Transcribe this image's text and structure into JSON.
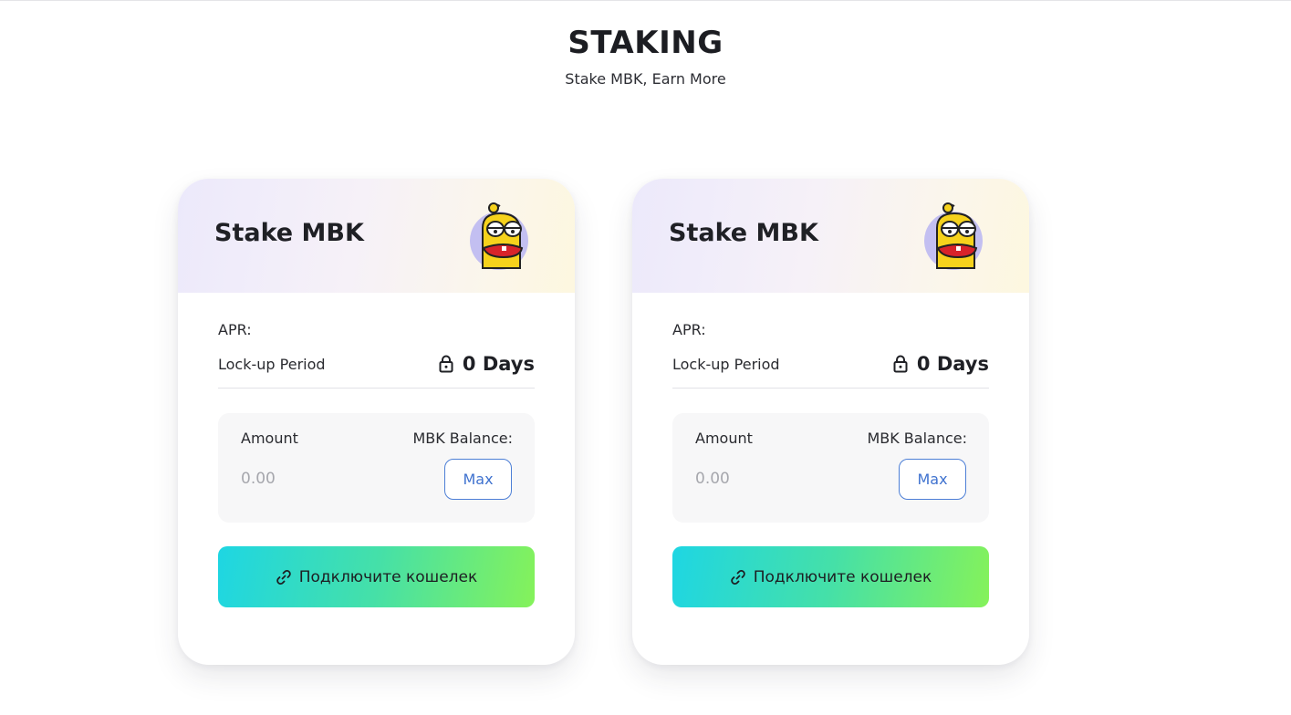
{
  "header": {
    "title": "STAKING",
    "subtitle": "Stake MBK, Earn More"
  },
  "cards": [
    {
      "title": "Stake MBK",
      "apr_label": "APR:",
      "lock_label": "Lock-up Period",
      "lock_value": "0 Days",
      "amount_label": "Amount",
      "balance_label": "MBK Balance:",
      "amount_placeholder": "0.00",
      "max_label": "Max",
      "connect_label": "Подключите кошелек"
    },
    {
      "title": "Stake MBK",
      "apr_label": "APR:",
      "lock_label": "Lock-up Period",
      "lock_value": "0 Days",
      "amount_label": "Amount",
      "balance_label": "MBK Balance:",
      "amount_placeholder": "0.00",
      "max_label": "Max",
      "connect_label": "Подключите кошелек"
    }
  ],
  "icons": {
    "mascot": "duck-mascot-icon",
    "lock": "lock-icon",
    "link": "link-icon"
  },
  "colors": {
    "accent_blue": "#3f72cf",
    "gradient_start": "#1ed6e3",
    "gradient_end": "#85f25a"
  }
}
